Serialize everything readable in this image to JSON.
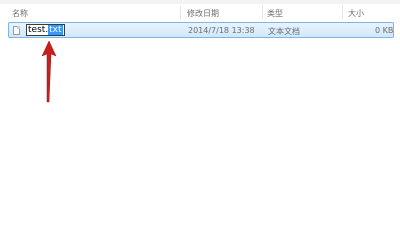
{
  "columns": {
    "name": "名称",
    "modified": "修改日期",
    "type": "类型",
    "size": "大小"
  },
  "file_row": {
    "name_base": "test.",
    "name_extension_selected": "txt",
    "modified": "2014/7/18 13:38",
    "type": "文本文档",
    "size": "0 KB",
    "icon": "text-file-icon"
  },
  "annotation": {
    "arrow_color": "#c81e1e"
  }
}
